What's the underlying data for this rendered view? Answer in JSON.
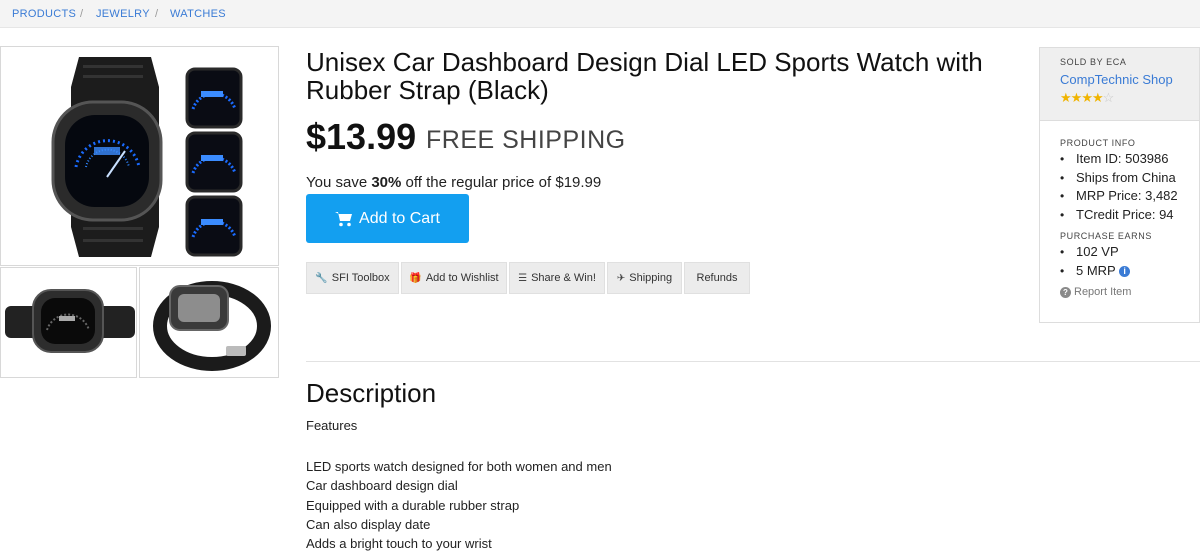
{
  "breadcrumb": {
    "items": [
      "PRODUCTS",
      "JEWELRY",
      "WATCHES"
    ],
    "separator": "/"
  },
  "product": {
    "title": "Unisex Car Dashboard Design Dial LED Sports Watch with Rubber Strap (Black)",
    "price": "$13.99",
    "shipping": "FREE SHIPPING",
    "save_prefix": "You save ",
    "save_pct": "30%",
    "save_suffix": " off the regular price of $19.99",
    "cart_label": "Add to Cart"
  },
  "actions": [
    {
      "label": "SFI Toolbox",
      "icon": "wrench-icon",
      "glyph": "🔧"
    },
    {
      "label": "Add to Wishlist",
      "icon": "gift-icon",
      "glyph": "🎁"
    },
    {
      "label": "Share & Win!",
      "icon": "share-icon",
      "glyph": "☰"
    },
    {
      "label": "Shipping",
      "icon": "plane-icon",
      "glyph": "✈"
    },
    {
      "label": "Refunds",
      "icon": "",
      "glyph": ""
    }
  ],
  "description": {
    "heading": "Description",
    "features_label": "Features",
    "features": [
      "LED sports watch designed for both women and men",
      "Car dashboard design dial",
      "Equipped with a durable rubber strap",
      "Can also display date",
      "Adds a bright touch to your wrist"
    ]
  },
  "seller": {
    "sold_by": "SOLD BY ECA",
    "shop_name": "CompTechnic Shop",
    "rating": 4,
    "rating_max": 5,
    "product_info_heading": "PRODUCT INFO",
    "product_info": [
      "Item ID: 503986",
      "Ships from China",
      "MRP Price: 3,482",
      "TCredit Price: 94"
    ],
    "purchase_earns_heading": "PURCHASE EARNS",
    "earns_vp": "102 VP",
    "earns_mrp": "5 MRP",
    "report_label": "Report Item"
  },
  "colors": {
    "link": "#3a7bd5",
    "cart_button": "#139ff0",
    "star": "#f0b400"
  }
}
